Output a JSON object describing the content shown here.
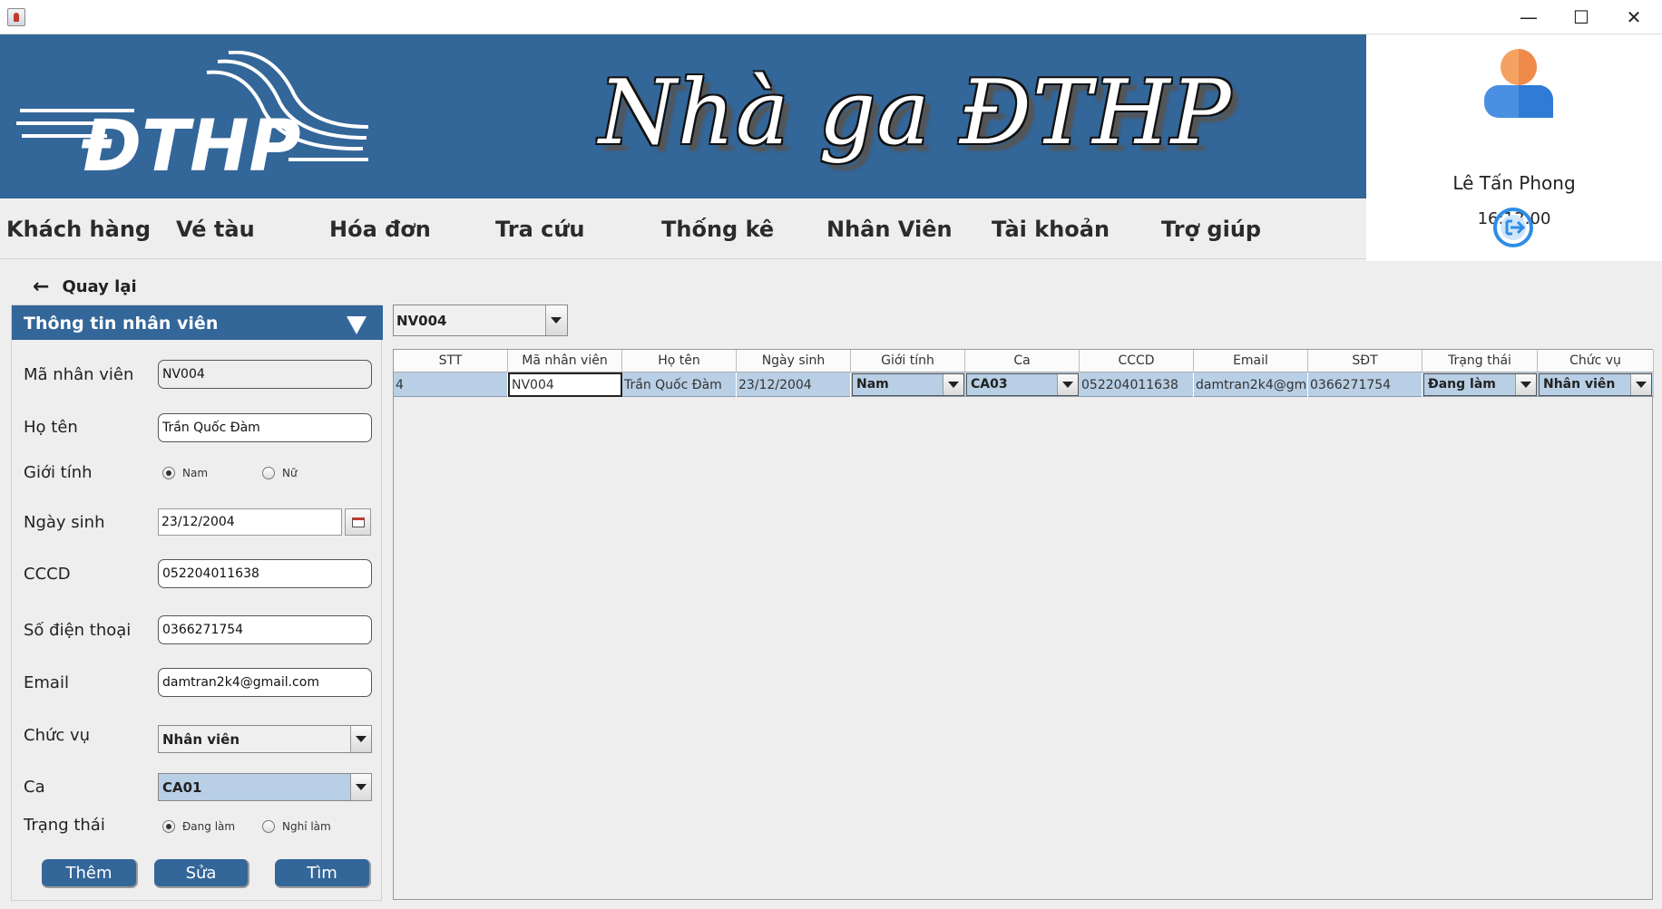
{
  "window": {
    "minimize": "—",
    "maximize": "☐",
    "close": "✕"
  },
  "banner": {
    "logo_text": "ĐTHP",
    "title": "Nhà ga ĐTHP",
    "color": "#336699"
  },
  "user": {
    "name": "Lê Tấn Phong",
    "time": "16:13:00"
  },
  "menu": {
    "items": [
      "Khách hàng",
      "Vé tàu",
      "Hóa đơn",
      "Tra cứu",
      "Thống kê",
      "Nhân Viên",
      "Tài khoản",
      "Trợ giúp"
    ]
  },
  "back": {
    "label": "Quay lại"
  },
  "form": {
    "header": "Thông tin nhân viên",
    "labels": {
      "employee_id": "Mã nhân viên",
      "full_name": "Họ tên",
      "gender": "Giới tính",
      "birth_date": "Ngày sinh",
      "id_card": "CCCD",
      "phone": "Số điện thoại",
      "email": "Email",
      "position": "Chức vụ",
      "shift": "Ca",
      "status": "Trạng thái"
    },
    "values": {
      "employee_id": "NV004",
      "full_name": "Trần Quốc Đàm",
      "birth_date": "23/12/2004",
      "id_card": "052204011638",
      "phone": "0366271754",
      "email": "damtran2k4@gmail.com",
      "position": "Nhân viên",
      "shift": "CA01"
    },
    "gender_options": {
      "male": "Nam",
      "female": "Nữ"
    },
    "gender_selected": "Nam",
    "status_options": {
      "working": "Đang làm",
      "resigned": "Nghỉ làm"
    },
    "status_selected": "Đang làm",
    "buttons": {
      "add": "Thêm",
      "edit": "Sửa",
      "search": "Tìm"
    }
  },
  "filter": {
    "selected": "NV004"
  },
  "table": {
    "columns": [
      "STT",
      "Mã nhân viên",
      "Họ tên",
      "Ngày sinh",
      "Giới tính",
      "Ca",
      "CCCD",
      "Email",
      "SĐT",
      "Trạng thái",
      "Chức vụ"
    ],
    "rows": [
      {
        "stt": "4",
        "employee_id": "NV004",
        "full_name": "Trần Quốc Đàm",
        "birth_date": "23/12/2004",
        "gender": "Nam",
        "shift": "CA03",
        "id_card": "052204011638",
        "email": "damtran2k4@gm...",
        "phone": "0366271754",
        "status": "Đang làm",
        "position": "Nhân viên"
      }
    ]
  },
  "colors": {
    "primary": "#336699",
    "selection": "#b8cfe5",
    "background": "#eeeeee"
  }
}
